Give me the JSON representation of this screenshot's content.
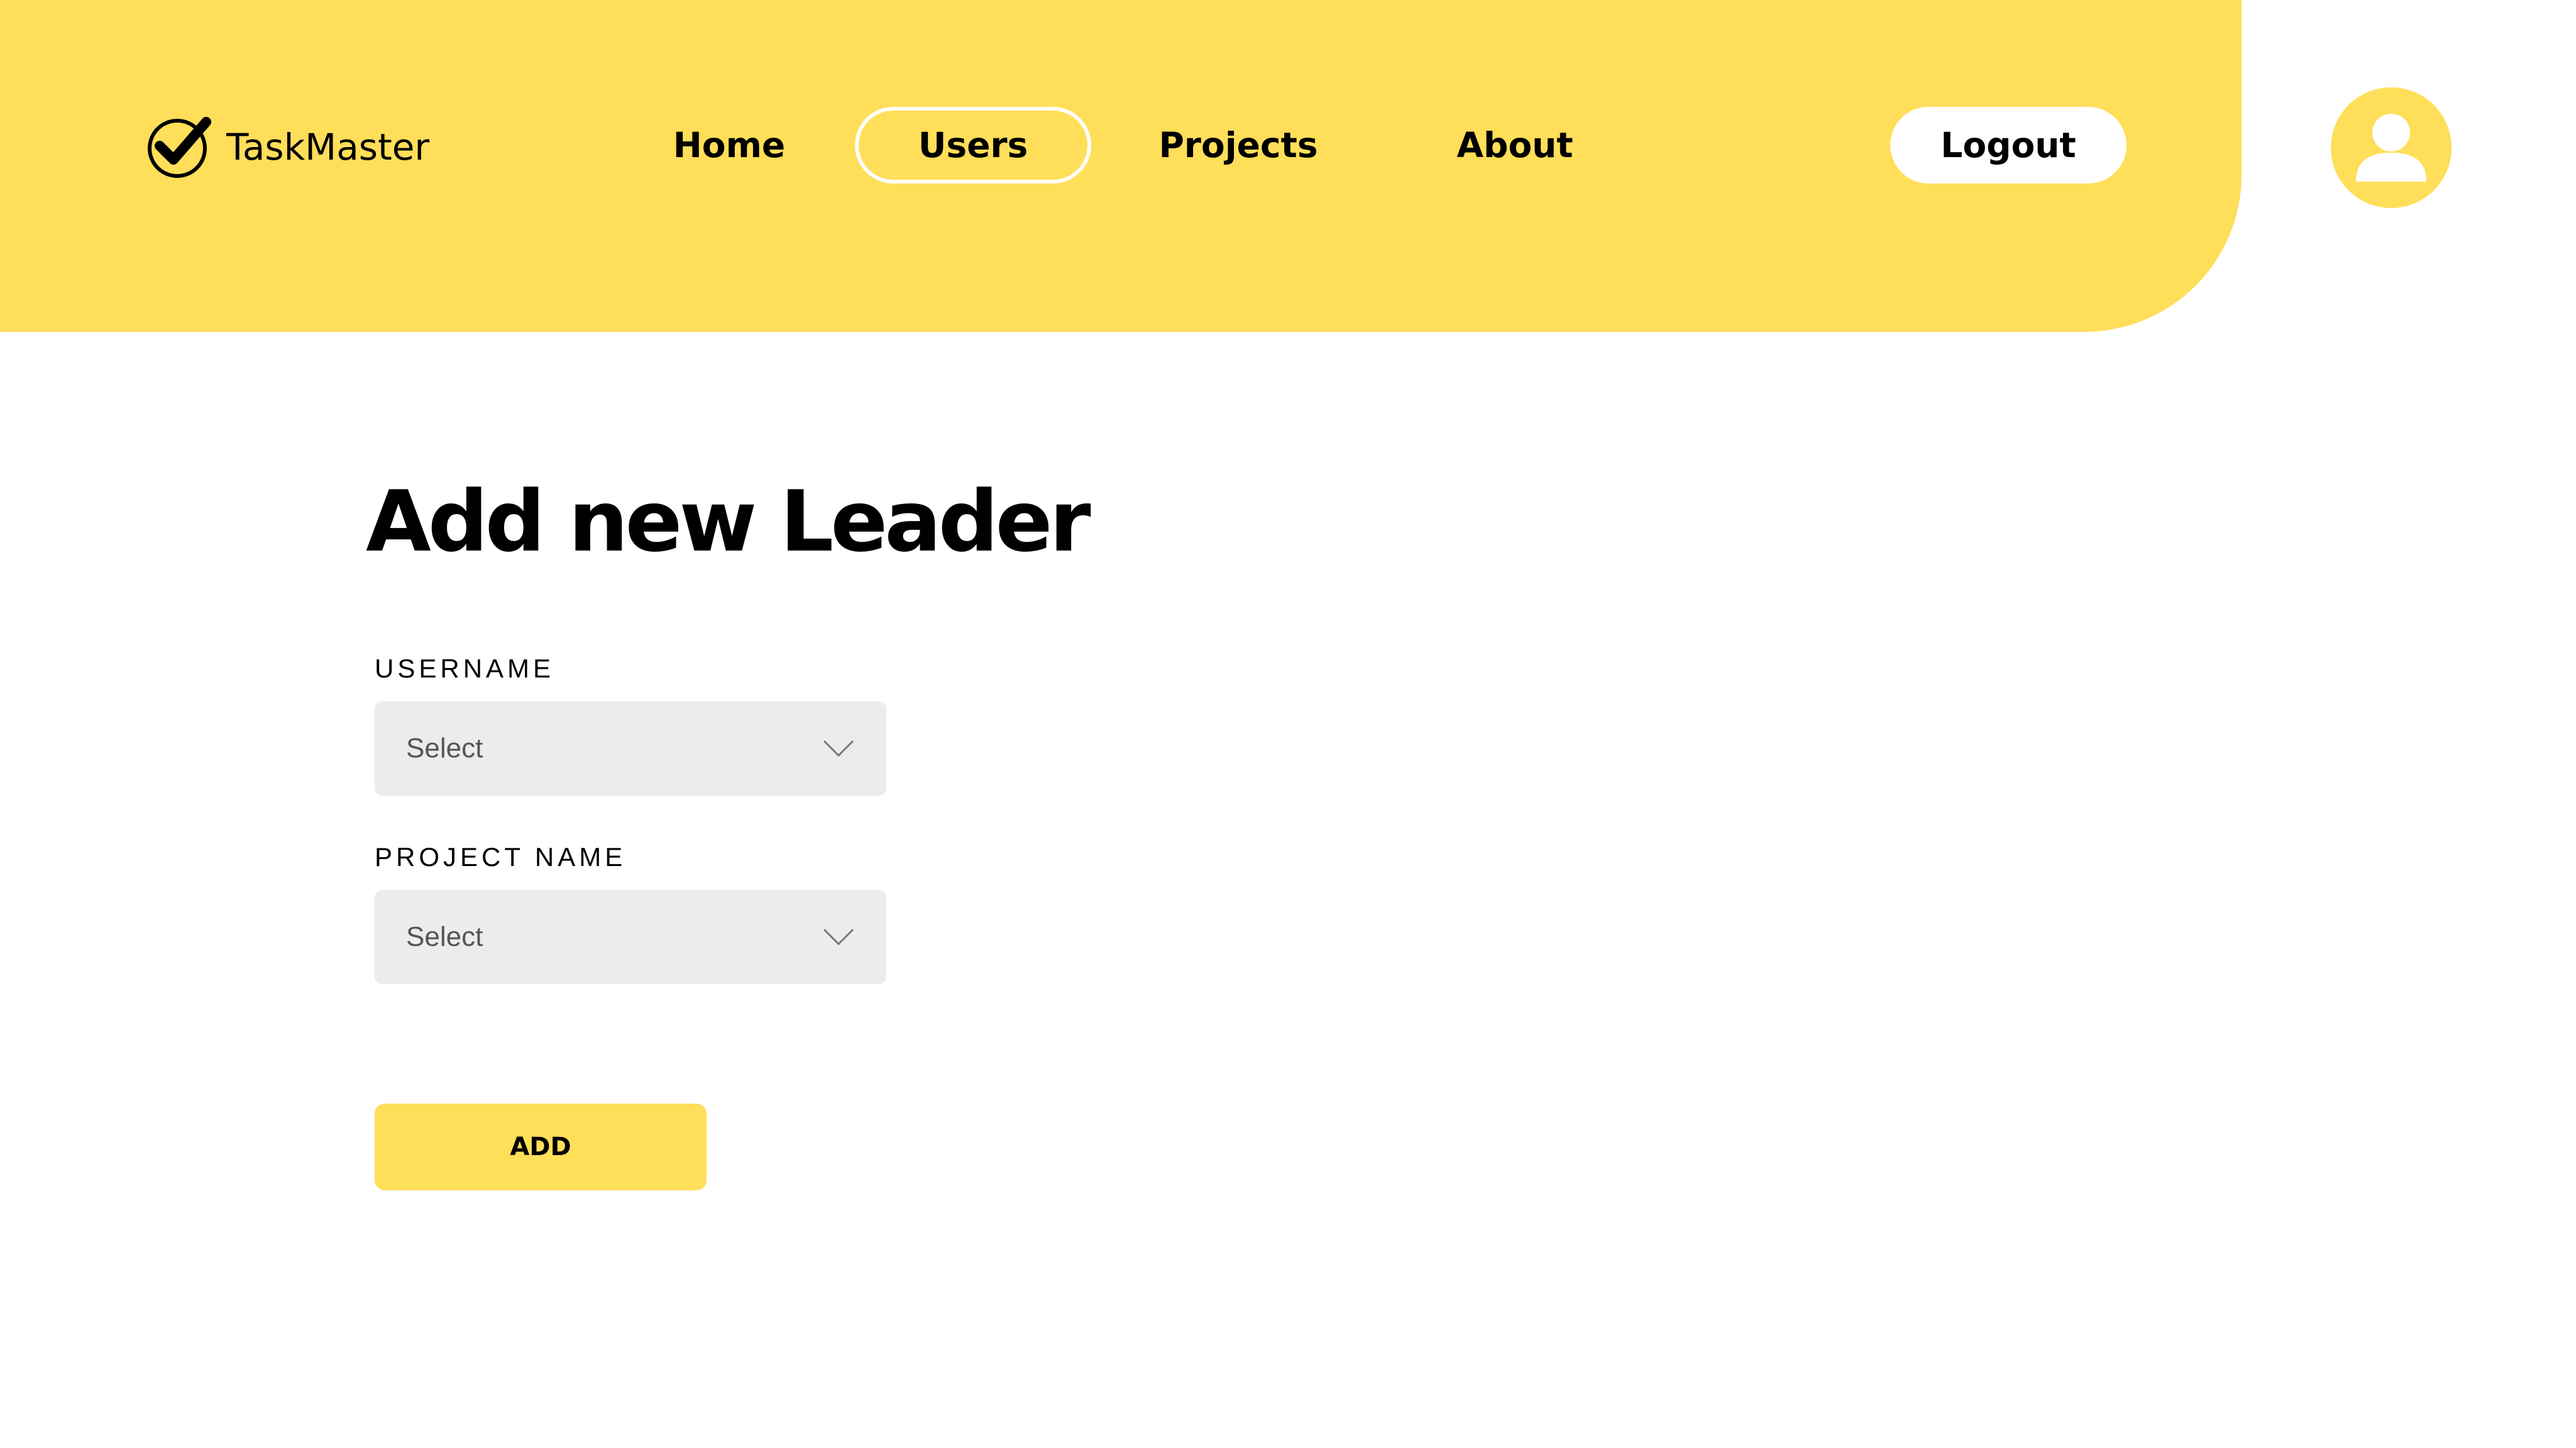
{
  "app": {
    "name": "TaskMaster",
    "accent_color": "#FFDE59",
    "logo_icon": "checkmark-circle-icon"
  },
  "nav": {
    "items": [
      {
        "label": "Home",
        "active": false
      },
      {
        "label": "Users",
        "active": true
      },
      {
        "label": "Projects",
        "active": false
      },
      {
        "label": "About",
        "active": false
      }
    ]
  },
  "header": {
    "logout_label": "Logout",
    "avatar_icon": "user-icon"
  },
  "main": {
    "title": "Add new Leader",
    "fields": [
      {
        "label": "USERNAME",
        "placeholder": "Select",
        "icon": "chevron-down-icon"
      },
      {
        "label": "PROJECT NAME",
        "placeholder": "Select",
        "icon": "chevron-down-icon"
      }
    ],
    "submit_label": "ADD"
  }
}
